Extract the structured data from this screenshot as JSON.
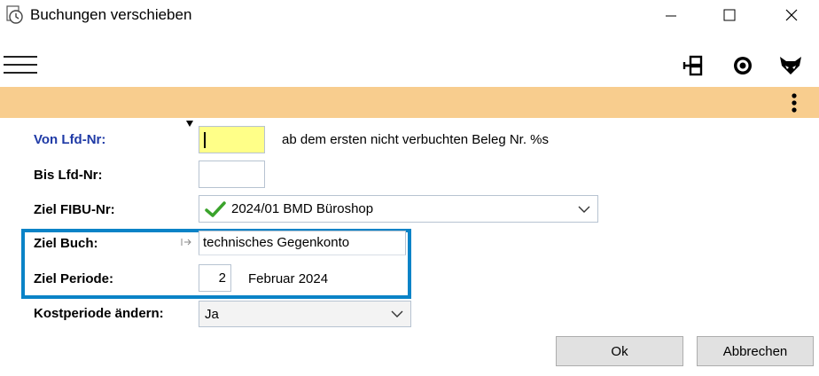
{
  "window": {
    "title": "Buchungen verschieben"
  },
  "form": {
    "von_lfd": {
      "label": "Von Lfd-Nr:",
      "value": "",
      "hint": "ab dem ersten nicht verbuchten Beleg Nr. %s"
    },
    "bis_lfd": {
      "label": "Bis Lfd-Nr:",
      "value": ""
    },
    "ziel_fibu": {
      "label": "Ziel FIBU-Nr:",
      "value": "2024/01 BMD Büroshop"
    },
    "ziel_buch": {
      "label": "Ziel Buch:",
      "value": "technisches Gegenkonto"
    },
    "ziel_periode": {
      "label": "Ziel Periode:",
      "value": "2",
      "month": "Februar 2024"
    },
    "kostperiode": {
      "label": "Kostperiode ändern:",
      "value": "Ja"
    }
  },
  "buttons": {
    "ok": "Ok",
    "cancel": "Abbrechen"
  },
  "colors": {
    "accent_bar": "#f8cd8e",
    "highlight_frame": "#0a83c7",
    "active_input": "#ffff88",
    "label_blue": "#1f3aa6"
  }
}
